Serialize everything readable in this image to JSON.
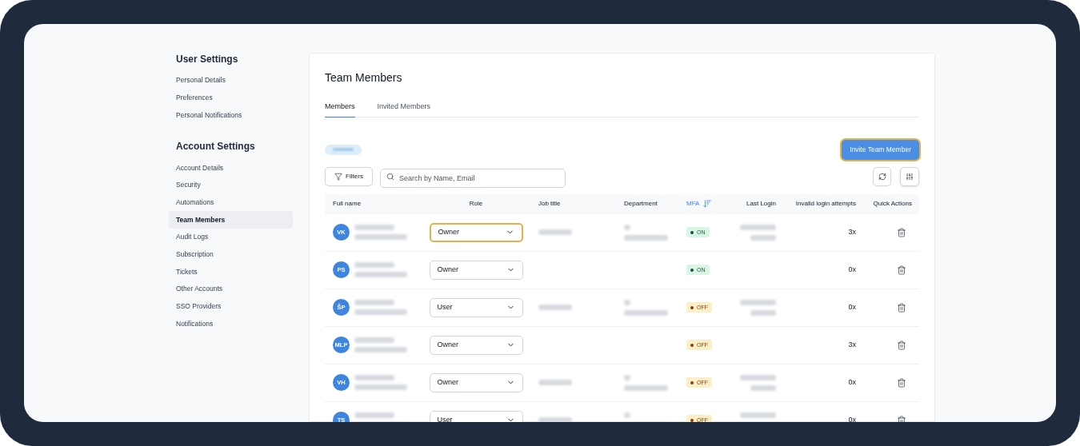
{
  "sidebar": {
    "sections": [
      {
        "title": "User Settings",
        "items": [
          {
            "label": "Personal Details",
            "selected": false
          },
          {
            "label": "Preferences",
            "selected": false
          },
          {
            "label": "Personal Notifications",
            "selected": false
          }
        ]
      },
      {
        "title": "Account Settings",
        "items": [
          {
            "label": "Account Details",
            "selected": false
          },
          {
            "label": "Security",
            "selected": false
          },
          {
            "label": "Automations",
            "selected": false
          },
          {
            "label": "Team Members",
            "selected": true
          },
          {
            "label": "Audit Logs",
            "selected": false
          },
          {
            "label": "Subscription",
            "selected": false
          },
          {
            "label": "Tickets",
            "selected": false
          },
          {
            "label": "Other Accounts",
            "selected": false
          },
          {
            "label": "SSO Providers",
            "selected": false
          },
          {
            "label": "Notifications",
            "selected": false
          }
        ]
      }
    ]
  },
  "page": {
    "title": "Team Members",
    "tabs": [
      {
        "label": "Members",
        "selected": true
      },
      {
        "label": "Invited Members",
        "selected": false
      }
    ],
    "invite_button": "Invite Team Member",
    "filters_button": "Filters",
    "search": {
      "placeholder": "Search by Name, Email"
    },
    "table": {
      "columns": [
        {
          "label": "Full name",
          "sort": false
        },
        {
          "label": "Role",
          "sort": false
        },
        {
          "label": "Job title",
          "sort": false
        },
        {
          "label": "Department",
          "sort": false
        },
        {
          "label": "MFA",
          "sort": true
        },
        {
          "label": "Last Login",
          "sort": false
        },
        {
          "label": "Invalid login attempts",
          "sort": false
        },
        {
          "label": "Quick Actions",
          "sort": false
        }
      ],
      "rows": [
        {
          "initials": "VK",
          "role": "Owner",
          "focused": true,
          "job_blurred": true,
          "department_blurred": true,
          "mfa": {
            "on": true,
            "label": "ON"
          },
          "login_blurred": true,
          "attempts": "3x"
        },
        {
          "initials": "PS",
          "role": "Owner",
          "focused": false,
          "job_blurred": false,
          "department_blurred": false,
          "mfa": {
            "on": true,
            "label": "ON"
          },
          "login_blurred": false,
          "attempts": "0x"
        },
        {
          "initials": "ŠP",
          "role": "User",
          "focused": false,
          "job_blurred": true,
          "department_blurred": true,
          "mfa": {
            "on": false,
            "label": "OFF"
          },
          "login_blurred": true,
          "attempts": "0x"
        },
        {
          "initials": "MLP",
          "role": "Owner",
          "focused": false,
          "job_blurred": false,
          "department_blurred": false,
          "mfa": {
            "on": false,
            "label": "OFF"
          },
          "login_blurred": false,
          "attempts": "3x"
        },
        {
          "initials": "VH",
          "role": "Owner",
          "focused": false,
          "job_blurred": true,
          "department_blurred": true,
          "mfa": {
            "on": false,
            "label": "OFF"
          },
          "login_blurred": true,
          "attempts": "0x"
        },
        {
          "initials": "TS",
          "role": "User",
          "focused": false,
          "job_blurred": true,
          "department_blurred": true,
          "mfa": {
            "on": false,
            "label": "OFF"
          },
          "login_blurred": true,
          "attempts": "0x"
        }
      ]
    }
  }
}
